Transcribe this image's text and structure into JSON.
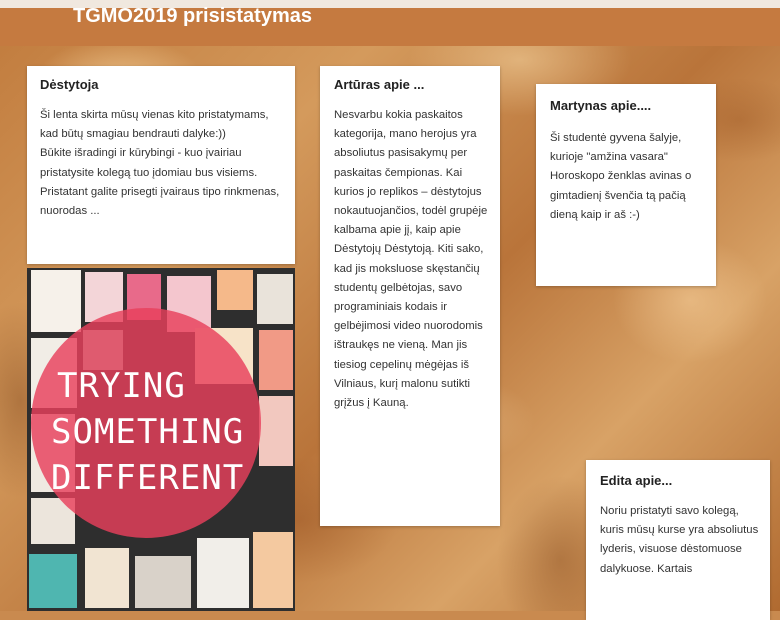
{
  "header": {
    "title": "TGMO2019 prisistatymas"
  },
  "cards": [
    {
      "title": "Dėstytoja",
      "text": "Ši lenta skirta mūsų vienas kito pristatymams, kad būtų smagiau bendrauti dalyke:))\nBūkite išradingi ir kūrybingi - kuo įvairiau pristatysite kolegą tuo įdomiau bus visiems. Pristatant galite prisegti įvairaus tipo rinkmenas, nuorodas ..."
    },
    {
      "title": "Artūras apie ...",
      "text": "Nesvarbu kokia paskaitos kategorija, mano herojus yra absoliutus pasisakymų per paskaitas čempionas. Kai kurios jo replikos – dėstytojus nokautuojančios, todėl grupėje kalbama apie jį, kaip apie Dėstytojų Dėstytoją. Kiti sako, kad jis moksluose skęstančių studentų gelbėtojas, savo programiniais kodais ir gelbėjimosi video nuorodomis ištraukęs ne vieną. Man jis tiesiog cepelinų mėgėjas iš Vilniaus, kurį malonu sutikti grįžus į Kauną."
    },
    {
      "title": "Martynas apie....",
      "text": "Ši studentė gyvena šalyje, kurioje \"amžina vasara\" Horoskopo ženklas avinas o gimtadienį švenčia tą pačią dieną kaip ir aš :-)"
    },
    {
      "title": "Edita apie...",
      "text": "Noriu pristatyti savo kolegą, kuris mūsų kurse yra absoliutus lyderis, visuose dėstomuose dalykuose.  Kartais"
    }
  ],
  "collage": {
    "lines": [
      "TRYING",
      "SOMETHING",
      "DIFFERENT"
    ]
  },
  "colors": {
    "header": "#c57a40",
    "cork": "#c98a4f",
    "circle": "#e8405c",
    "card": "#ffffff"
  }
}
